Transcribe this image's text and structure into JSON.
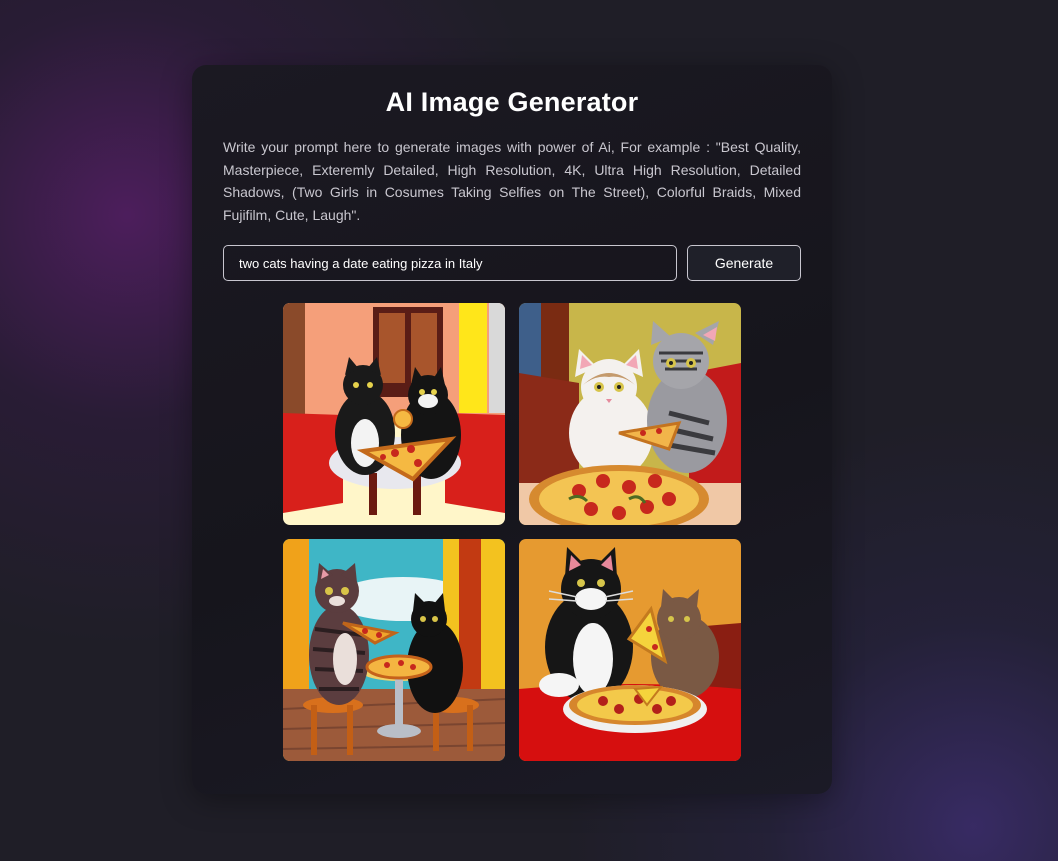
{
  "app": {
    "title": "AI Image Generator",
    "description": "Write your prompt here to generate images with power of Ai, For example : \"Best Quality, Masterpiece, Exteremly Detailed, High Resolution, 4K, Ultra High Resolution, Detailed Shadows, (Two Girls in Cosumes Taking Selfies on The Street), Colorful Braids, Mixed Fujifilm, Cute, Laugh\"."
  },
  "prompt": {
    "value": "two cats having a date eating pizza in Italy"
  },
  "generate_button": {
    "label": "Generate"
  },
  "results": [
    {
      "id": "image-1",
      "scene": "black-and-white cats sharing pizza at a red café table"
    },
    {
      "id": "image-2",
      "scene": "white cat and grey tabby with a pepperoni pizza"
    },
    {
      "id": "image-3",
      "scene": "tabby cat and black cat at a small outdoor table"
    },
    {
      "id": "image-4",
      "scene": "tuxedo cat and brown cat with pizza on a red table"
    }
  ]
}
